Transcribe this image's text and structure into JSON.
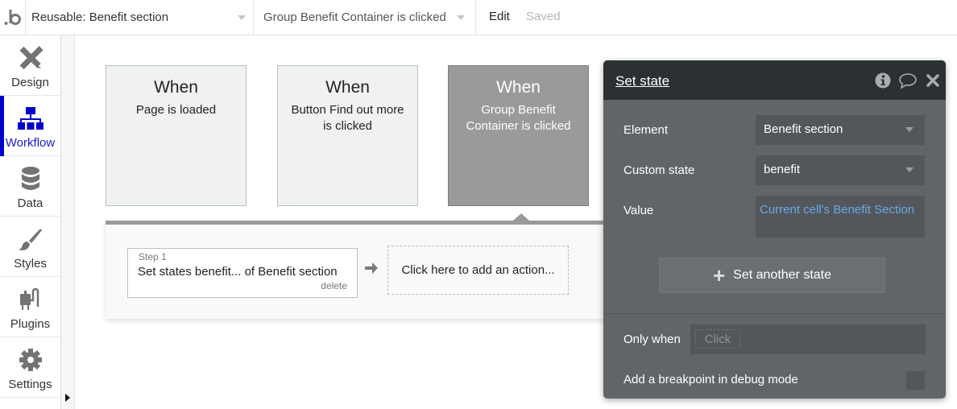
{
  "topbar": {
    "logo": "b",
    "page_selector": "Reusable: Benefit section",
    "event_selector": "Group Benefit Container is clicked",
    "edit_label": "Edit",
    "save_status": "Saved"
  },
  "sidebar": {
    "items": [
      {
        "label": "Design",
        "icon": "design-icon",
        "active": false
      },
      {
        "label": "Workflow",
        "icon": "workflow-icon",
        "active": true
      },
      {
        "label": "Data",
        "icon": "database-icon",
        "active": false
      },
      {
        "label": "Styles",
        "icon": "brush-icon",
        "active": false
      },
      {
        "label": "Plugins",
        "icon": "plug-icon",
        "active": false
      },
      {
        "label": "Settings",
        "icon": "gear-icon",
        "active": false
      }
    ],
    "active_color": "#0000cc"
  },
  "events": [
    {
      "when": "When",
      "description": "Page is loaded",
      "selected": false
    },
    {
      "when": "When",
      "description": "Button Find out more is clicked",
      "selected": false
    },
    {
      "when": "When",
      "description": "Group Benefit Container is clicked",
      "selected": true
    }
  ],
  "actions": {
    "steps": [
      {
        "step_label": "Step 1",
        "title": "Set states benefit... of Benefit section",
        "delete_label": "delete"
      }
    ],
    "add_action_label": "Click here to add an action..."
  },
  "panel": {
    "title": "Set state",
    "icons": [
      "info-icon",
      "comment-icon",
      "close-icon"
    ],
    "fields": {
      "element_label": "Element",
      "element_value": "Benefit section",
      "custom_state_label": "Custom state",
      "custom_state_value": "benefit",
      "value_label": "Value",
      "value_expression": "Current cell's Benefit Section"
    },
    "set_another_label": "Set another state",
    "only_when_label": "Only when",
    "only_when_placeholder": "Click",
    "breakpoint_label": "Add a breakpoint in debug mode",
    "breakpoint_checked": false,
    "expression_color": "#6aa8e8"
  }
}
